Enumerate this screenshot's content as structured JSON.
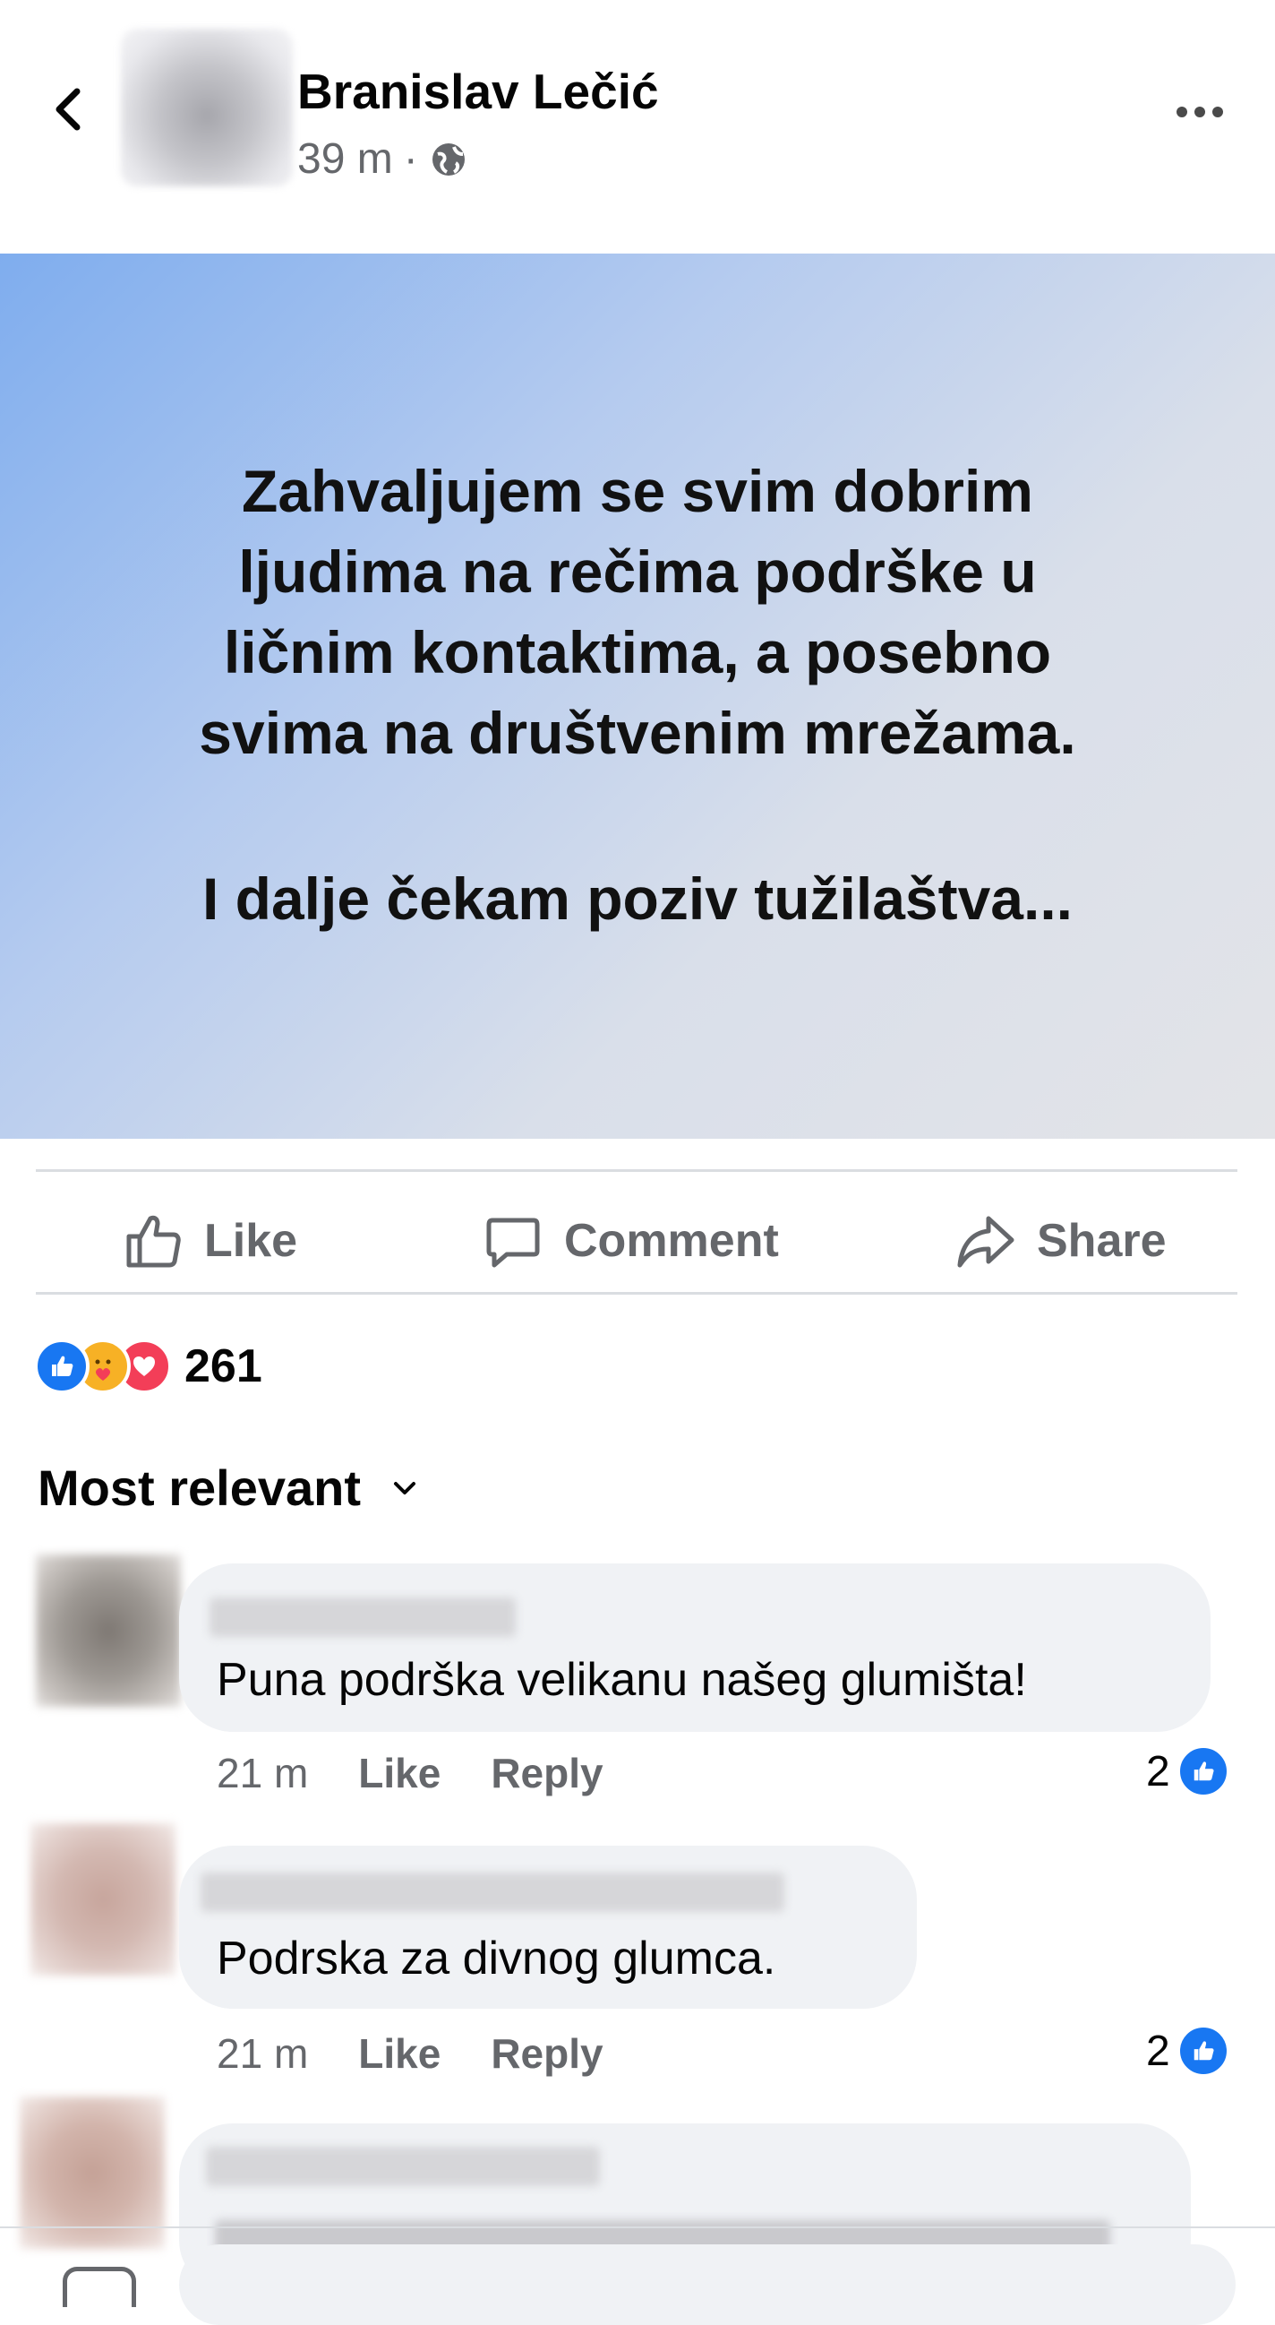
{
  "header": {
    "author": "Branislav Lečić",
    "time": "39 m",
    "separator": "·"
  },
  "post": {
    "lines": [
      "Zahvaljujem se svim dobrim",
      "ljudima na rečima podrške u",
      "ličnim kontaktima, a posebno",
      "svima na društvenim mrežama."
    ],
    "closing": "I dalje čekam poziv tužilaštva..."
  },
  "actions": {
    "like": "Like",
    "comment": "Comment",
    "share": "Share"
  },
  "reactions": {
    "count": "261",
    "types": [
      "like",
      "care",
      "love"
    ]
  },
  "sort": {
    "label": "Most relevant"
  },
  "comments": [
    {
      "text": "Puna podrška velikanu našeg glumišta!",
      "time": "21 m",
      "like": "Like",
      "reply": "Reply",
      "likes": "2"
    },
    {
      "text": "Podrska za divnog glumca.",
      "time": "21 m",
      "like": "Like",
      "reply": "Reply",
      "likes": "2"
    }
  ],
  "colors": {
    "accent": "#1877f2",
    "love": "#f33e58",
    "care": "#f7b125",
    "muted_text": "#65676b",
    "bubble": "#f0f2f5"
  }
}
